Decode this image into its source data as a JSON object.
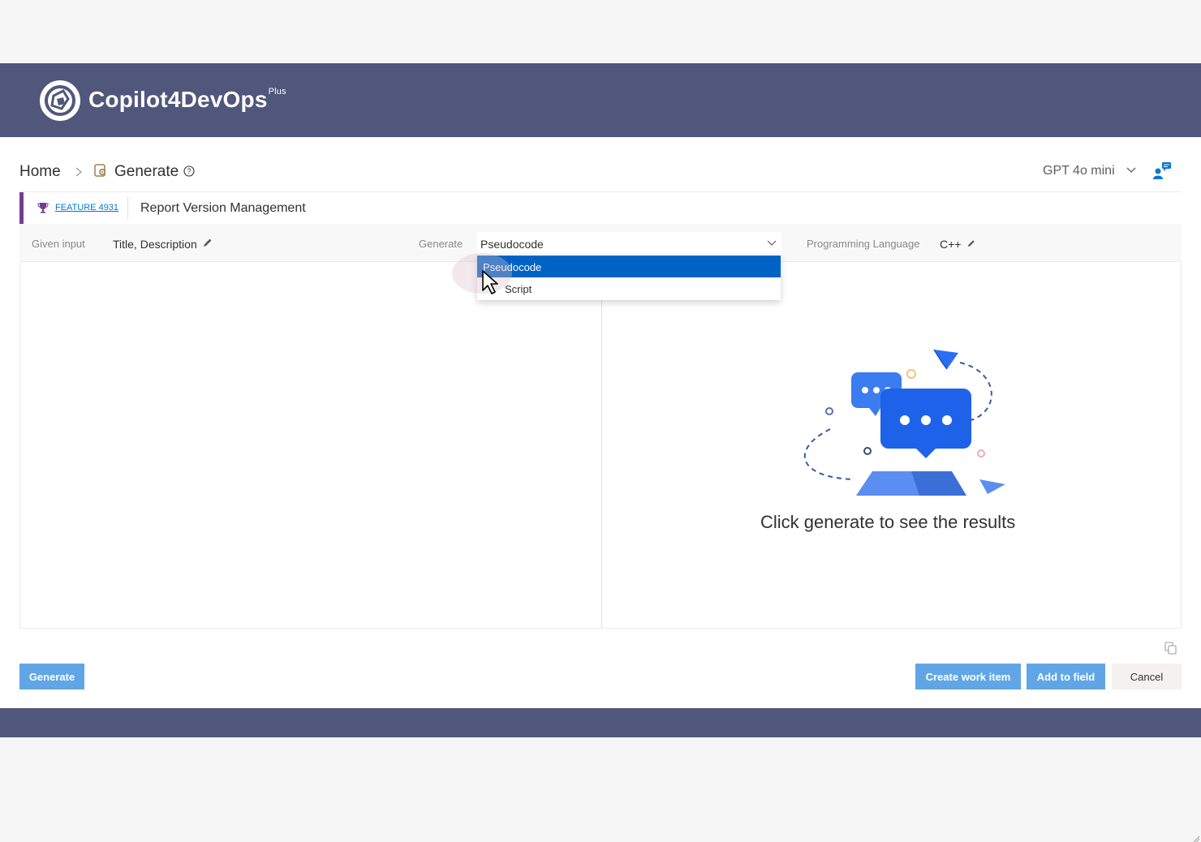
{
  "app": {
    "name": "Copilot4DevOps",
    "superscript": "Plus",
    "header_color": "#50577a"
  },
  "breadcrumb": {
    "home": "Home",
    "current": "Generate"
  },
  "model_selector": {
    "value": "GPT 4o mini"
  },
  "work_item": {
    "type_label": "FEATURE 4931",
    "title": "Report Version Management",
    "accent_color": "#773b93"
  },
  "options": {
    "given_input_label": "Given input",
    "given_input_value": "Title, Description",
    "generate_label": "Generate",
    "generate_value": "Pseudocode",
    "language_label": "Programming Language",
    "language_value": "C++"
  },
  "generate_dropdown": {
    "items": [
      "Pseudocode",
      "Script"
    ],
    "selected_index": 0,
    "selected_color": "#0063c4"
  },
  "results": {
    "empty_message": "Click generate to see the results"
  },
  "buttons": {
    "generate": "Generate",
    "create_work_item": "Create work item",
    "add_to_field": "Add to field",
    "cancel": "Cancel",
    "primary_color": "#60a6e6"
  },
  "icons": [
    "copilot-logo-icon",
    "chevron-right-icon",
    "generate-gear-icon",
    "help-icon",
    "chevron-down-icon",
    "feedback-icon",
    "trophy-icon",
    "pencil-icon",
    "copy-icon",
    "mouse-pointer-icon"
  ]
}
